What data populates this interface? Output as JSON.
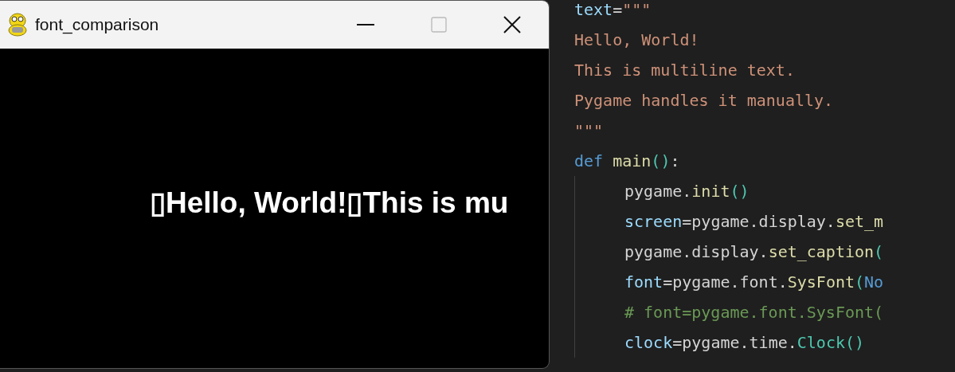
{
  "editor": {
    "lines": [
      {
        "tokens": [
          {
            "kind": "var",
            "text": "text"
          },
          {
            "kind": "op",
            "text": "="
          },
          {
            "kind": "str",
            "text": "\"\"\""
          }
        ]
      },
      {
        "tokens": [
          {
            "kind": "str",
            "text": "Hello, World!"
          }
        ]
      },
      {
        "tokens": [
          {
            "kind": "str",
            "text": "This is multiline text."
          }
        ]
      },
      {
        "tokens": [
          {
            "kind": "str",
            "text": "Pygame handles it manually."
          }
        ]
      },
      {
        "tokens": [
          {
            "kind": "str",
            "text": "\"\"\""
          }
        ]
      },
      {
        "tokens": [
          {
            "kind": "kw",
            "text": "def"
          },
          {
            "kind": "fn",
            "text": " main"
          },
          {
            "kind": "paren",
            "text": "()"
          },
          {
            "kind": "op",
            "text": ":"
          }
        ],
        "children": [
          {
            "tokens": [
              {
                "kind": "plain",
                "text": "pygame."
              },
              {
                "kind": "fn",
                "text": "init"
              },
              {
                "kind": "paren",
                "text": "()"
              }
            ]
          },
          {
            "tokens": [
              {
                "kind": "var",
                "text": "screen"
              },
              {
                "kind": "op",
                "text": "="
              },
              {
                "kind": "plain",
                "text": "pygame.display."
              },
              {
                "kind": "fn",
                "text": "set_m"
              }
            ]
          },
          {
            "tokens": [
              {
                "kind": "plain",
                "text": "pygame.display."
              },
              {
                "kind": "fn",
                "text": "set_caption"
              },
              {
                "kind": "paren",
                "text": "("
              }
            ]
          },
          {
            "tokens": [
              {
                "kind": "var",
                "text": "font"
              },
              {
                "kind": "op",
                "text": "="
              },
              {
                "kind": "plain",
                "text": "pygame.font."
              },
              {
                "kind": "fn",
                "text": "SysFont"
              },
              {
                "kind": "paren",
                "text": "("
              },
              {
                "kind": "kw",
                "text": "No"
              }
            ]
          },
          {
            "tokens": [
              {
                "kind": "comment",
                "text": "# font=pygame.font.SysFont("
              }
            ]
          },
          {
            "tokens": [
              {
                "kind": "var",
                "text": "clock"
              },
              {
                "kind": "op",
                "text": "="
              },
              {
                "kind": "plain",
                "text": "pygame.time."
              },
              {
                "kind": "cls",
                "text": "Clock"
              },
              {
                "kind": "paren",
                "text": "()"
              }
            ]
          }
        ]
      }
    ]
  },
  "window": {
    "title": "font_comparison",
    "maximize_disabled": true,
    "content": "▯Hello, World!▯This is mu"
  }
}
